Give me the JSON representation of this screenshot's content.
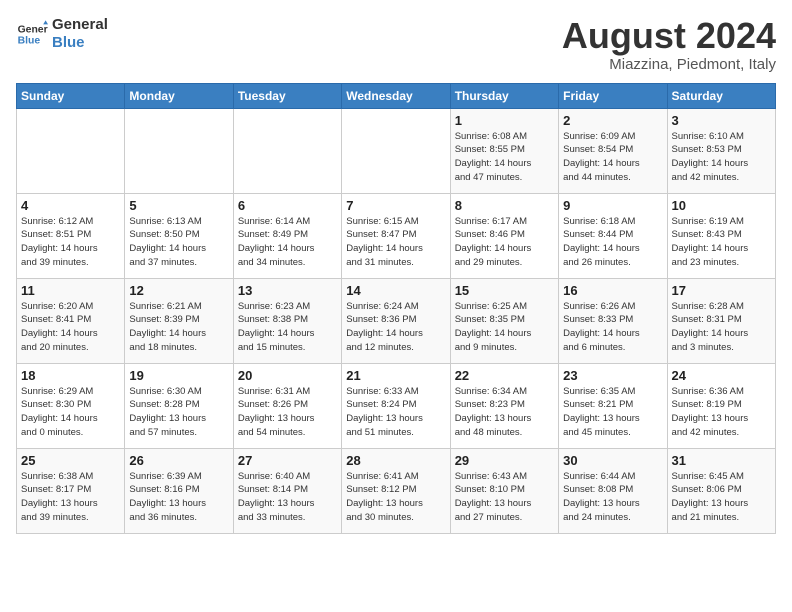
{
  "logo": {
    "line1": "General",
    "line2": "Blue"
  },
  "title": "August 2024",
  "location": "Miazzina, Piedmont, Italy",
  "days_of_week": [
    "Sunday",
    "Monday",
    "Tuesday",
    "Wednesday",
    "Thursday",
    "Friday",
    "Saturday"
  ],
  "weeks": [
    [
      {
        "day": "",
        "info": ""
      },
      {
        "day": "",
        "info": ""
      },
      {
        "day": "",
        "info": ""
      },
      {
        "day": "",
        "info": ""
      },
      {
        "day": "1",
        "info": "Sunrise: 6:08 AM\nSunset: 8:55 PM\nDaylight: 14 hours\nand 47 minutes."
      },
      {
        "day": "2",
        "info": "Sunrise: 6:09 AM\nSunset: 8:54 PM\nDaylight: 14 hours\nand 44 minutes."
      },
      {
        "day": "3",
        "info": "Sunrise: 6:10 AM\nSunset: 8:53 PM\nDaylight: 14 hours\nand 42 minutes."
      }
    ],
    [
      {
        "day": "4",
        "info": "Sunrise: 6:12 AM\nSunset: 8:51 PM\nDaylight: 14 hours\nand 39 minutes."
      },
      {
        "day": "5",
        "info": "Sunrise: 6:13 AM\nSunset: 8:50 PM\nDaylight: 14 hours\nand 37 minutes."
      },
      {
        "day": "6",
        "info": "Sunrise: 6:14 AM\nSunset: 8:49 PM\nDaylight: 14 hours\nand 34 minutes."
      },
      {
        "day": "7",
        "info": "Sunrise: 6:15 AM\nSunset: 8:47 PM\nDaylight: 14 hours\nand 31 minutes."
      },
      {
        "day": "8",
        "info": "Sunrise: 6:17 AM\nSunset: 8:46 PM\nDaylight: 14 hours\nand 29 minutes."
      },
      {
        "day": "9",
        "info": "Sunrise: 6:18 AM\nSunset: 8:44 PM\nDaylight: 14 hours\nand 26 minutes."
      },
      {
        "day": "10",
        "info": "Sunrise: 6:19 AM\nSunset: 8:43 PM\nDaylight: 14 hours\nand 23 minutes."
      }
    ],
    [
      {
        "day": "11",
        "info": "Sunrise: 6:20 AM\nSunset: 8:41 PM\nDaylight: 14 hours\nand 20 minutes."
      },
      {
        "day": "12",
        "info": "Sunrise: 6:21 AM\nSunset: 8:39 PM\nDaylight: 14 hours\nand 18 minutes."
      },
      {
        "day": "13",
        "info": "Sunrise: 6:23 AM\nSunset: 8:38 PM\nDaylight: 14 hours\nand 15 minutes."
      },
      {
        "day": "14",
        "info": "Sunrise: 6:24 AM\nSunset: 8:36 PM\nDaylight: 14 hours\nand 12 minutes."
      },
      {
        "day": "15",
        "info": "Sunrise: 6:25 AM\nSunset: 8:35 PM\nDaylight: 14 hours\nand 9 minutes."
      },
      {
        "day": "16",
        "info": "Sunrise: 6:26 AM\nSunset: 8:33 PM\nDaylight: 14 hours\nand 6 minutes."
      },
      {
        "day": "17",
        "info": "Sunrise: 6:28 AM\nSunset: 8:31 PM\nDaylight: 14 hours\nand 3 minutes."
      }
    ],
    [
      {
        "day": "18",
        "info": "Sunrise: 6:29 AM\nSunset: 8:30 PM\nDaylight: 14 hours\nand 0 minutes."
      },
      {
        "day": "19",
        "info": "Sunrise: 6:30 AM\nSunset: 8:28 PM\nDaylight: 13 hours\nand 57 minutes."
      },
      {
        "day": "20",
        "info": "Sunrise: 6:31 AM\nSunset: 8:26 PM\nDaylight: 13 hours\nand 54 minutes."
      },
      {
        "day": "21",
        "info": "Sunrise: 6:33 AM\nSunset: 8:24 PM\nDaylight: 13 hours\nand 51 minutes."
      },
      {
        "day": "22",
        "info": "Sunrise: 6:34 AM\nSunset: 8:23 PM\nDaylight: 13 hours\nand 48 minutes."
      },
      {
        "day": "23",
        "info": "Sunrise: 6:35 AM\nSunset: 8:21 PM\nDaylight: 13 hours\nand 45 minutes."
      },
      {
        "day": "24",
        "info": "Sunrise: 6:36 AM\nSunset: 8:19 PM\nDaylight: 13 hours\nand 42 minutes."
      }
    ],
    [
      {
        "day": "25",
        "info": "Sunrise: 6:38 AM\nSunset: 8:17 PM\nDaylight: 13 hours\nand 39 minutes."
      },
      {
        "day": "26",
        "info": "Sunrise: 6:39 AM\nSunset: 8:16 PM\nDaylight: 13 hours\nand 36 minutes."
      },
      {
        "day": "27",
        "info": "Sunrise: 6:40 AM\nSunset: 8:14 PM\nDaylight: 13 hours\nand 33 minutes."
      },
      {
        "day": "28",
        "info": "Sunrise: 6:41 AM\nSunset: 8:12 PM\nDaylight: 13 hours\nand 30 minutes."
      },
      {
        "day": "29",
        "info": "Sunrise: 6:43 AM\nSunset: 8:10 PM\nDaylight: 13 hours\nand 27 minutes."
      },
      {
        "day": "30",
        "info": "Sunrise: 6:44 AM\nSunset: 8:08 PM\nDaylight: 13 hours\nand 24 minutes."
      },
      {
        "day": "31",
        "info": "Sunrise: 6:45 AM\nSunset: 8:06 PM\nDaylight: 13 hours\nand 21 minutes."
      }
    ]
  ]
}
